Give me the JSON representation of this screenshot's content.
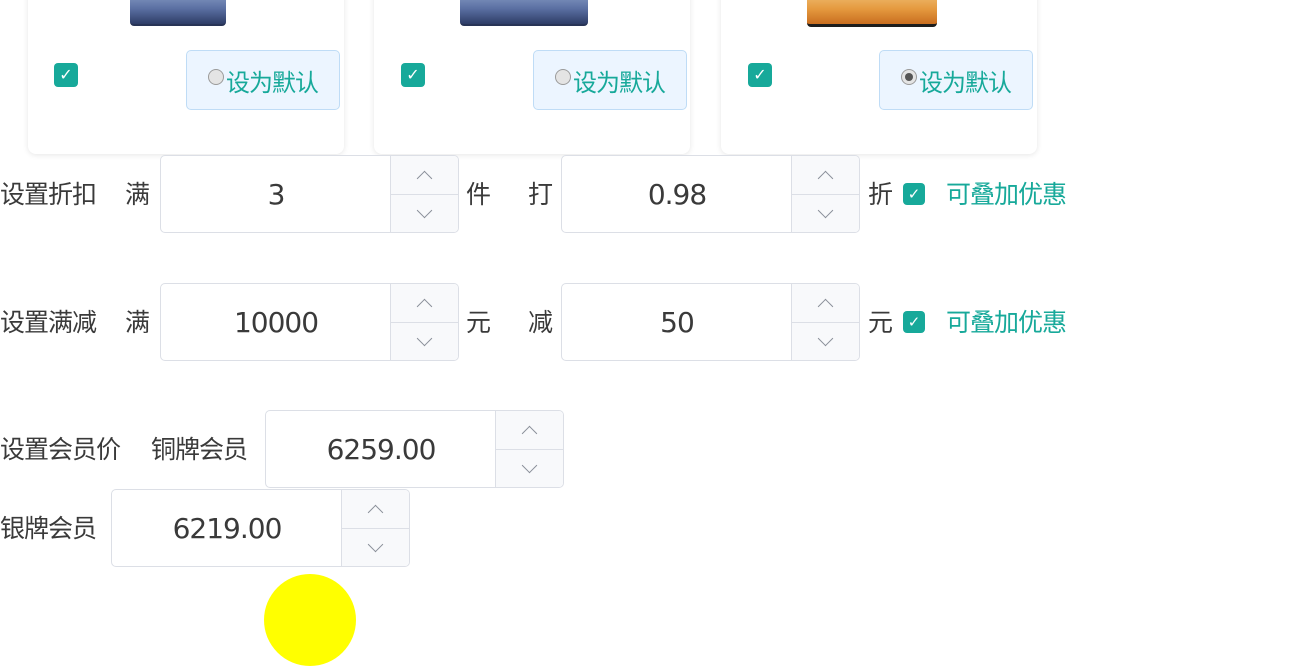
{
  "cards": [
    {
      "checked": true,
      "default_label": "设为默认",
      "is_default": false
    },
    {
      "checked": true,
      "default_label": "设为默认",
      "is_default": false
    },
    {
      "checked": true,
      "default_label": "设为默认",
      "is_default": true
    }
  ],
  "discount": {
    "label": "设置折扣",
    "full_label": "满",
    "quantity": "3",
    "unit": "件",
    "hit_label": "打",
    "rate": "0.98",
    "rate_unit": "折",
    "stackable_checked": true,
    "stackable_label": "可叠加优惠"
  },
  "full_reduction": {
    "label": "设置满减",
    "full_label": "满",
    "threshold": "10000",
    "threshold_unit": "元",
    "minus_label": "减",
    "amount": "50",
    "amount_unit": "元",
    "stackable_checked": true,
    "stackable_label": "可叠加优惠"
  },
  "member_price": {
    "label": "设置会员价",
    "bronze_label": "铜牌会员",
    "bronze_value": "6259.00",
    "silver_label": "银牌会员",
    "silver_value": "6219.00"
  },
  "colors": {
    "accent": "#17a99a",
    "button_bg": "#ecf5ff",
    "button_border": "#bfdcf6",
    "cursor_highlight": "#ffff00"
  },
  "icons": {
    "checkbox": "check-icon",
    "stepper_up": "chevron-up-icon",
    "stepper_down": "chevron-down-icon"
  }
}
